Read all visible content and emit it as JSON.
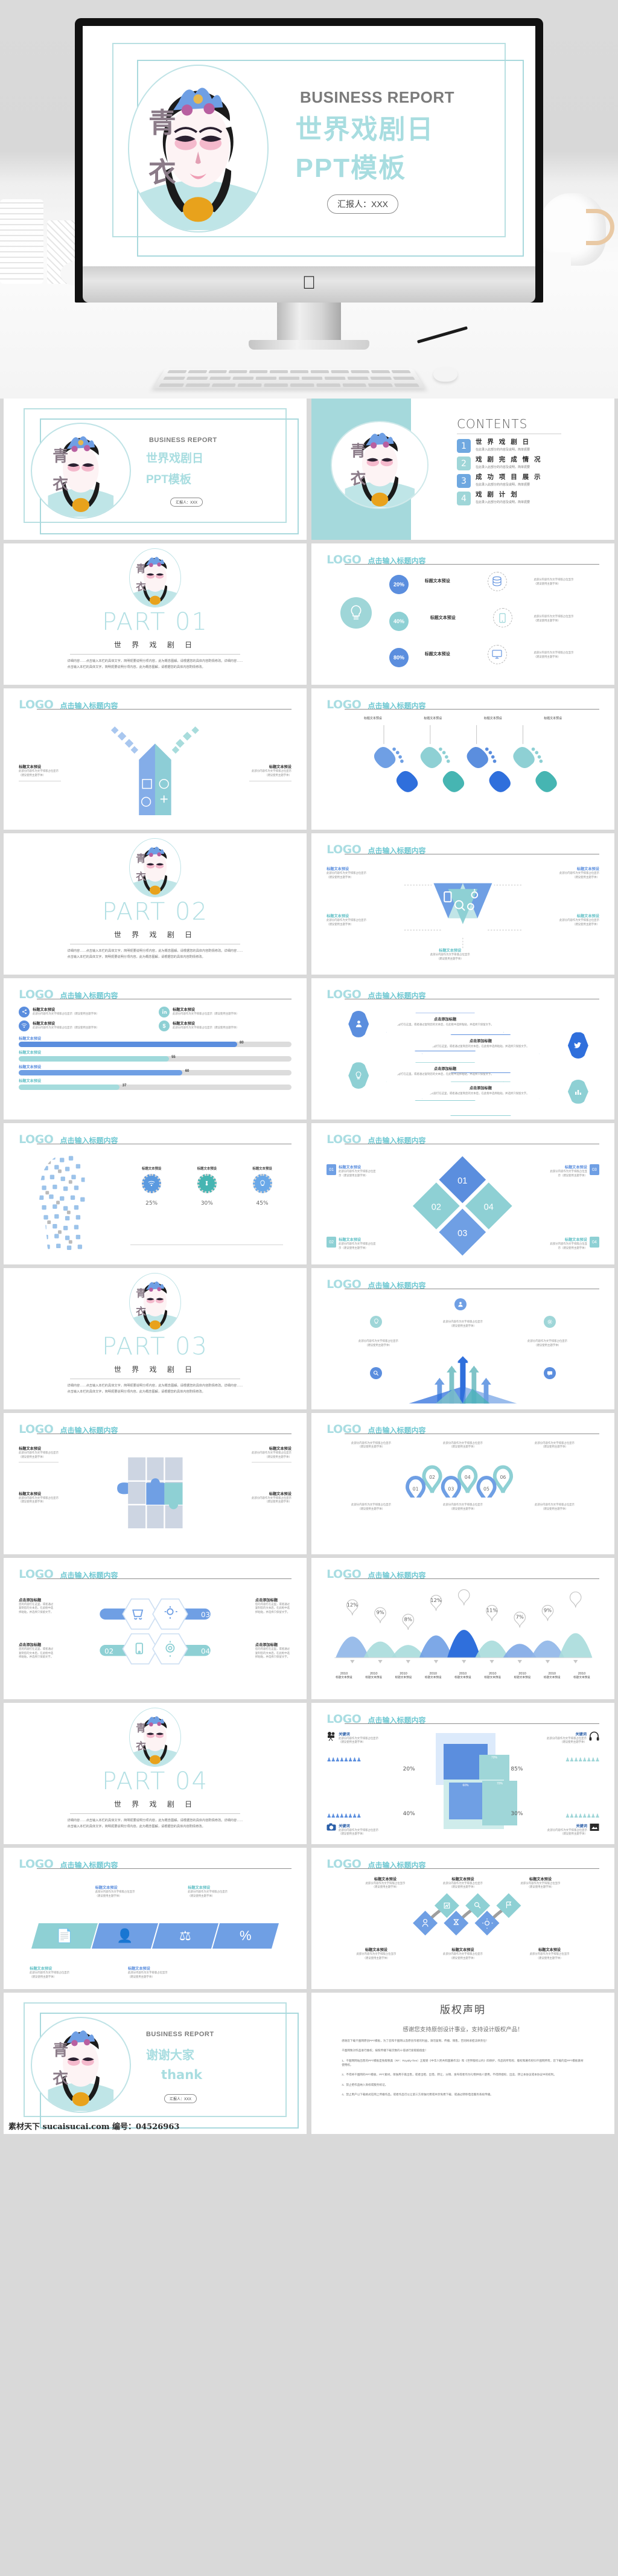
{
  "cover": {
    "eyebrow": "BUSINESS REPORT",
    "title_line1": "世界戏剧日",
    "title_line2": "PPT模板",
    "presenter": "汇报人：XXX",
    "mark_top": "青",
    "mark_bottom": "衣"
  },
  "contents": {
    "title": "CONTENTS",
    "items": [
      {
        "num": "1",
        "heading": "世 界 戏 剧 日",
        "sub": "在此录入此部分的内容及说明，简单扼要",
        "color": "#6fa8e0"
      },
      {
        "num": "2",
        "heading": "戏 剧 完 成 情 况",
        "sub": "在此录入此部分的内容及说明，简单扼要",
        "color": "#9fd6d8"
      },
      {
        "num": "3",
        "heading": "成 功 项 目 展 示",
        "sub": "在此录入此部分的内容及说明，简单扼要",
        "color": "#6fa8e0"
      },
      {
        "num": "4",
        "heading": "戏  剧  计  划",
        "sub": "在此录入此部分的内容及说明，简单扼要",
        "color": "#9fd6d8"
      }
    ]
  },
  "slide_header": {
    "logo": "LOGO",
    "title": "点击输入标题内容"
  },
  "parts": [
    {
      "no": "PART 01",
      "cn": "世 界 戏 剧 日",
      "body": "详细内容……点击输入本栏的具体文字，简明扼要说明分项内容，此为概念图解，请根据您的具体内容酌情修改。详细内容……点击输入本栏的具体文字，简明扼要说明分项内容，此为概念图解，请根据您的具体内容酌情修改。"
    },
    {
      "no": "PART 02",
      "cn": "世 界 戏 剧 日",
      "body": "详细内容……点击输入本栏的具体文字，简明扼要说明分项内容，此为概念图解，请根据您的具体内容酌情修改。详细内容……点击输入本栏的具体文字，简明扼要说明分项内容，此为概念图解，请根据您的具体内容酌情修改。"
    },
    {
      "no": "PART 03",
      "cn": "世 界 戏 剧 日",
      "body": "详细内容……点击输入本栏的具体文字，简明扼要说明分项内容，此为概念图解，请根据您的具体内容酌情修改。详细内容……点击输入本栏的具体文字，简明扼要说明分项内容，此为概念图解，请根据您的具体内容酌情修改。"
    },
    {
      "no": "PART 04",
      "cn": "世 界 戏 剧 日",
      "body": "详细内容……点击输入本栏的具体文字，简明扼要说明分项内容，此为概念图解，请根据您的具体内容酌情修改。详细内容……点击输入本栏的具体文字，简明扼要说明分项内容，此为概念图解，请根据您的具体内容酌情修改。"
    }
  ],
  "common": {
    "title_preset": "标题文本预设",
    "placeholder_line1": "此部分内容作为文字排版占位显示",
    "placeholder_line2": "（建议使用主题字体）",
    "add_title": "点击添加标题",
    "add_body": "您的内容打在这里，或者通过复制您的文本后，在此框中选择粘贴，并选择只保留文字。",
    "keyword": "关键词"
  },
  "slide_percent": {
    "rows": [
      {
        "pct": "20%",
        "title": "标题文本预设",
        "icon": "database-icon",
        "color": "#5b8ede"
      },
      {
        "pct": "40%",
        "title": "标题文本预设",
        "icon": "mobile-icon",
        "color": "#8ed0d4"
      },
      {
        "pct": "80%",
        "title": "标题文本预设",
        "icon": "monitor-icon",
        "color": "#5b8ede"
      }
    ]
  },
  "slide_bars": {
    "items": [
      {
        "label": "标题文本预设",
        "value": 80,
        "color": "#5b8ede"
      },
      {
        "label": "标题文本预设",
        "value": 55,
        "color": "#9fd9db"
      },
      {
        "label": "标题文本预设",
        "value": 60,
        "color": "#6f9fe4"
      },
      {
        "label": "标题文本预设",
        "value": 37,
        "color": "#a5dcdd"
      }
    ],
    "icon_items": [
      {
        "label": "标题文本预设",
        "sub": "此部分内容作为文字排版占位显示（建议使用主题字体）",
        "icon": "share-icon",
        "color": "#5b8ede"
      },
      {
        "label": "标题文本预设",
        "sub": "此部分内容作为文字排版占位显示（建议使用主题字体）",
        "icon": "linkedin-icon",
        "color": "#8ed0d4"
      },
      {
        "label": "标题文本预设",
        "sub": "此部分内容作为文字排版占位显示（建议使用主题字体）",
        "icon": "wifi-icon",
        "color": "#5b8ede"
      },
      {
        "label": "标题文本预设",
        "sub": "此部分内容作为文字排版占位显示（建议使用主题字体）",
        "icon": "dollar-icon",
        "color": "#8ed0d4"
      }
    ]
  },
  "slide_head_icons": {
    "columns": [
      {
        "label": "标题文本预设",
        "pct": "25%",
        "icon": "wifi-icon",
        "color": "#5b9ae0"
      },
      {
        "label": "标题文本预设",
        "pct": "30%",
        "icon": "drop-icon",
        "color": "#46b5b2"
      },
      {
        "label": "标题文本预设",
        "pct": "45%",
        "icon": "bulb-icon",
        "color": "#6aa8e8"
      }
    ]
  },
  "slide_diamond_cycle": {
    "nodes": [
      {
        "no": "01",
        "label": "标题文本预设",
        "sub": "此部分内容作为文字排版占位显示（建议使用主题字体）",
        "color": "#5b8ede"
      },
      {
        "no": "02",
        "label": "标题文本预设",
        "sub": "此部分内容作为文字排版占位显示（建议使用主题字体）",
        "color": "#8ed0d4"
      },
      {
        "no": "03",
        "label": "标题文本预设",
        "sub": "此部分内容作为文字排版占位显示（建议使用主题字体）",
        "color": "#5b8ede"
      },
      {
        "no": "04",
        "label": "标题文本预设",
        "sub": "此部分内容作为文字排版占位显示（建议使用主题字体）",
        "color": "#8ed0d4"
      }
    ]
  },
  "slide_pins": {
    "pins": [
      {
        "no": "01",
        "sub": "此部分内容作为文字排版占位显示（建议使用主题字体）",
        "color": "#6f9fe4"
      },
      {
        "no": "02",
        "sub": "此部分内容作为文字排版占位显示（建议使用主题字体）",
        "color": "#8ed0d4"
      },
      {
        "no": "03",
        "sub": "此部分内容作为文字排版占位显示（建议使用主题字体）",
        "color": "#6f9fe4"
      },
      {
        "no": "04",
        "sub": "此部分内容作为文字排版占位显示（建议使用主题字体）",
        "color": "#8ed0d4"
      },
      {
        "no": "05",
        "sub": "此部分内容作为文字排版占位显示（建议使用主题字体）",
        "color": "#6f9fe4"
      },
      {
        "no": "06",
        "sub": "此部分内容作为文字排版占位显示（建议使用主题字体）",
        "color": "#8ed0d4"
      }
    ]
  },
  "slide_hex4": {
    "nodes": [
      {
        "no": "01",
        "title": "点击添加标题",
        "body": "您的内容打在这里，或者通过复制您的文本后，在此框中选择粘贴，并选择只保留文字。",
        "icon": "cart-icon",
        "color": "#6f9fe4"
      },
      {
        "no": "02",
        "title": "点击添加标题",
        "body": "您的内容打在这里，或者通过复制您的文本后，在此框中选择粘贴，并选择只保留文字。",
        "icon": "mobile-icon",
        "color": "#8ed0d4"
      },
      {
        "no": "03",
        "title": "点击添加标题",
        "body": "您的内容打在这里，或者通过复制您的文本后，在此框中选择粘贴，并选择只保留文字。",
        "icon": "gear-icon",
        "color": "#6f9fe4"
      },
      {
        "no": "04",
        "title": "点击添加标题",
        "body": "您的内容打在这里，或者通过复制您的文本后，在此框中选择粘贴，并选择只保留文字。",
        "icon": "target-icon",
        "color": "#8ed0d4"
      }
    ]
  },
  "slide_keyword_blocks": {
    "items": [
      {
        "keyword": "关键词",
        "pct": "20%",
        "inner": "80%",
        "icon": "camera-video-icon",
        "color": "#5b8ede"
      },
      {
        "keyword": "关键词",
        "pct": "85%",
        "inner": "70%",
        "icon": "headphone-icon",
        "color": "#8ed0d4"
      },
      {
        "keyword": "关键词",
        "pct": "40%",
        "inner": "60%",
        "icon": "camera-icon",
        "color": "#5b8ede"
      },
      {
        "keyword": "关键词",
        "pct": "30%",
        "inner": "70%",
        "icon": "picture-icon",
        "color": "#8ed0d4"
      }
    ]
  },
  "slide_paral": {
    "icons": [
      "document-search-icon",
      "user-tie-icon",
      "scales-icon",
      "percent-icon"
    ],
    "labels": [
      "标题文本预设",
      "标题文本预设",
      "标题文本预设",
      "标题文本预设"
    ]
  },
  "slide_diamond_chain": {
    "top": [
      {
        "label": "标题文本预设",
        "icon": "chart-icon"
      },
      {
        "label": "标题文本预设",
        "icon": "search-icon"
      },
      {
        "label": "标题文本预设",
        "icon": "flag-icon"
      }
    ],
    "bottom": [
      {
        "label": "标题文本预设",
        "icon": "user-icon"
      },
      {
        "label": "标题文本预设",
        "icon": "hourglass-icon"
      },
      {
        "label": "标题文本预设",
        "icon": "gear-icon"
      }
    ]
  },
  "chart_data": {
    "type": "area",
    "title": "",
    "xlabel": "",
    "ylabel": "",
    "categories": [
      "2010",
      "2010",
      "2010",
      "2010",
      "2010",
      "2010",
      "2010",
      "2010",
      "2010"
    ],
    "tick_sublabels": [
      "标题文本预设",
      "标题文本预设",
      "标题文本预设",
      "标题文本预设",
      "标题文本预设",
      "标题文本预设",
      "标题文本预设",
      "标题文本预设",
      "标题文本预设"
    ],
    "values": [
      12,
      9,
      8,
      12,
      18,
      11,
      7,
      9,
      14
    ],
    "data_labels": [
      "12%",
      "9%",
      "8%",
      "12%",
      "",
      "11%",
      "7%",
      "9%",
      ""
    ],
    "colors": [
      "#8fb6e8",
      "#a8dcdc",
      "#a8dcdc",
      "#6f9fe4",
      "#2f6fdc",
      "#a8dcdc",
      "#7fa9e6",
      "#8fb6e8",
      "#a8dcdc"
    ],
    "ylim": [
      0,
      20
    ],
    "grid": false,
    "legend": "none"
  },
  "thanks": {
    "eyebrow": "BUSINESS REPORT",
    "line1": "谢谢大家",
    "line2": "thank",
    "presenter": "汇报人：XXX"
  },
  "copyright": {
    "title": "版权声明",
    "subtitle": "感谢您支持原创设计事业，支持设计版权产品！",
    "paras": [
      "感谢您下载千图网原创PPT模板，为了您和千图网以及原创作者的利益，请勿复制、传播、销售，否则将承担法律责任！",
      "千图网致对作品进行维权，按照传播下载次数的十倍进行索取赔偿金！",
      "1、千图网网站出售的PPT模板是免版税类（RF：Royalty-free）正版受《中华人民共和国著作法》和《世界版权公约》四保护，作品的所有权、版权和著作权归千图网所有，您下载的是PPT模板素材使用权。",
      "2、不得将千图网的PPT模板、PPT素材，单独用于再出售，或者出租、出借、转让、分销、发布或者作为礼物供他人使用，不得转授权、出卖、转让本协议或本协议中的权利。",
      "3、禁止把作品纳入商标或服务标记。",
      "4、禁止用户以下载格式在网上传播作品，或者作品可以让第三方单独付费或共享免费下载、或通过转移电话服务系统传播。"
    ]
  },
  "footer": {
    "site": "素材天下 sucaisucai.com",
    "id_label": "编号：",
    "id_value": "04526963"
  }
}
